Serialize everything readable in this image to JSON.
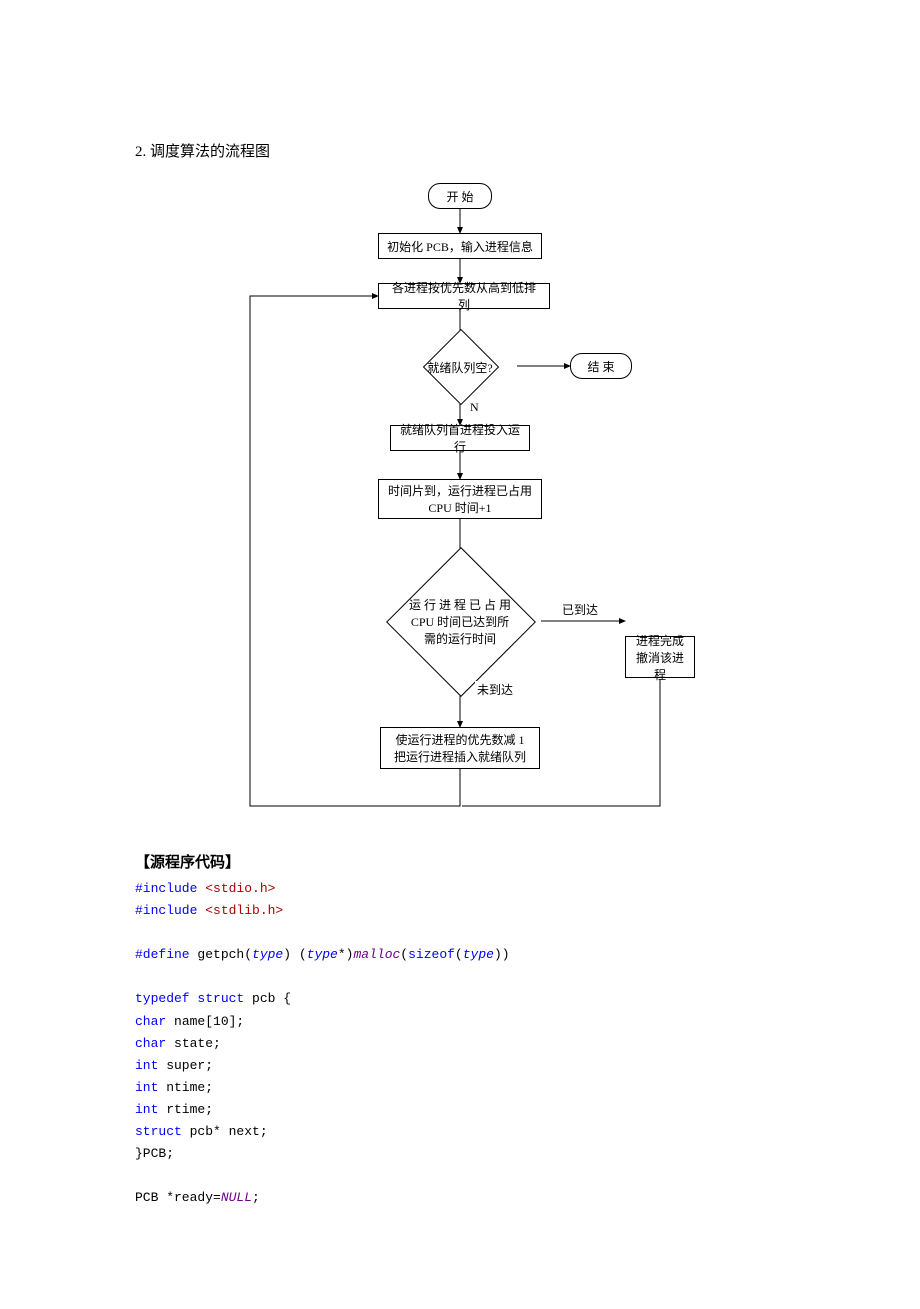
{
  "section_title": "2.  调度算法的流程图",
  "flow": {
    "start": "开  始",
    "init": "初始化 PCB，输入进程信息",
    "sort": "各进程按优先数从高到低排列",
    "empty_q": "就绪队列空?",
    "end": "结  束",
    "label_n": "N",
    "run_first": "就绪队列首进程投入运行",
    "timeslice": "时间片到，运行进程已占用\nCPU 时间+1",
    "check": "运 行 进 程 已 占 用\nCPU  时间已达到所\n需的运行时间",
    "label_reached": "已到达",
    "label_not": "未到达",
    "complete": "进程完成\n撤消该进程",
    "decrement": "使运行进程的优先数减 1\n把运行进程插入就绪队列"
  },
  "source_title": "【源程序代码】",
  "code": {
    "l1a": "#include",
    "l1b": " <stdio.h>",
    "l2a": "#include",
    "l2b": " <stdlib.h>",
    "l3a": "#define",
    "l3b": " getpch(",
    "l3c": "type",
    "l3d": ") (",
    "l3e": "type",
    "l3f": "*)",
    "l3g": "malloc",
    "l3h": "(",
    "l3i": "sizeof",
    "l3j": "(",
    "l3k": "type",
    "l3l": "))",
    "l4a": "typedef",
    "l4b": " struct",
    "l4c": " pcb {",
    "l5a": "char",
    "l5b": " name[10];",
    "l6a": "char",
    "l6b": " state;",
    "l7a": "int",
    "l7b": " super;",
    "l8a": "int",
    "l8b": " ntime;",
    "l9a": "int",
    "l9b": " rtime;",
    "l10a": "struct",
    "l10b": " pcb* next;",
    "l11": "}PCB;",
    "l12a": "PCB *ready=",
    "l12b": "NULL",
    "l12c": ";"
  }
}
